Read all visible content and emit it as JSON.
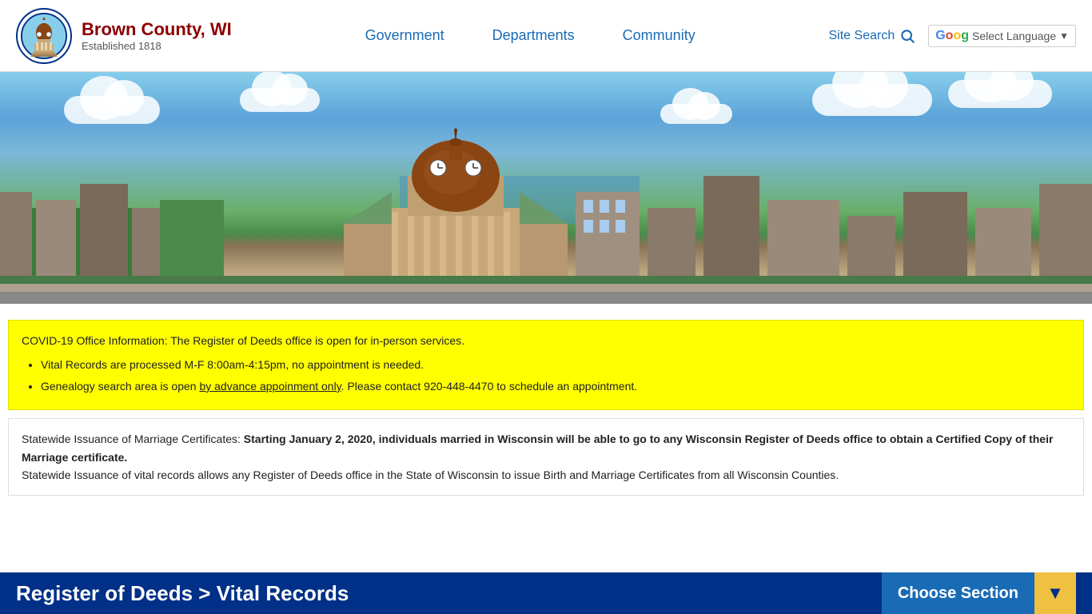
{
  "header": {
    "logo": {
      "icon": "🏛",
      "title": "Brown County, WI",
      "subtitle": "Established 1818"
    },
    "nav": {
      "government": "Government",
      "departments": "Departments",
      "community": "Community"
    },
    "search_label": "Site Search",
    "translate_label": "Select Language",
    "translate_arrow": "▼"
  },
  "alert": {
    "main_text": "COVID-19 Office Information: The Register of Deeds office is open for in-person services.",
    "bullet1": "Vital Records are processed M-F 8:00am-4:15pm, no appointment is needed.",
    "bullet2_prefix": "Genealogy search area is open ",
    "bullet2_link": "by advance appoinment only",
    "bullet2_suffix": ". Please contact 920-448-4470 to schedule an appointment."
  },
  "info": {
    "label": "Statewide Issuance of Marriage Certificates:",
    "bold_text": " Starting January 2, 2020, individuals married in Wisconsin will be able to go to any Wisconsin Register of Deeds office to obtain a Certified Copy of their Marriage certificate.",
    "text2": "Statewide Issuance of vital records allows any Register of Deeds office in the State of Wisconsin to issue Birth and Marriage Certificates from all Wisconsin Counties."
  },
  "footer": {
    "title": "Register of Deeds > Vital Records",
    "choose_section": "Choose Section",
    "arrow": "▼"
  }
}
